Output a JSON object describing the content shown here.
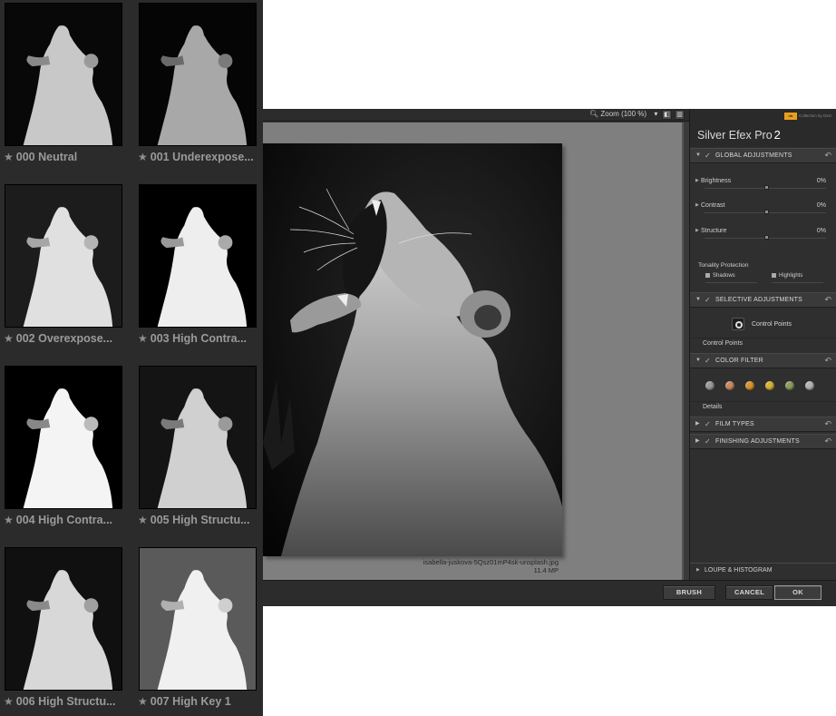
{
  "presets": [
    {
      "label": "000 Neutral"
    },
    {
      "label": "001 Underexpose..."
    },
    {
      "label": "002 Overexpose..."
    },
    {
      "label": "003 High Contra..."
    },
    {
      "label": "004 High Contra..."
    },
    {
      "label": "005 High Structu..."
    },
    {
      "label": "006 High Structu..."
    },
    {
      "label": "007 High Key 1"
    }
  ],
  "toolbar": {
    "zoom_label": "Zoom (100 %)"
  },
  "image": {
    "filename": "isabella-juskova-5Qsz01mP4sk-unsplash.jpg",
    "size": "11.4 MP"
  },
  "brand": {
    "collection": "Collection by DxO",
    "title": "Silver Efex Pro",
    "version": "2"
  },
  "global": {
    "header": "GLOBAL ADJUSTMENTS",
    "sliders": [
      {
        "name": "Brightness",
        "value": "0%"
      },
      {
        "name": "Contrast",
        "value": "0%"
      },
      {
        "name": "Structure",
        "value": "0%"
      }
    ],
    "tonality_label": "Tonality Protection",
    "shadows_label": "Shadows",
    "highlights_label": "Highlights"
  },
  "selective": {
    "header": "SELECTIVE ADJUSTMENTS",
    "control_points_button": "Control Points",
    "control_points_row": "Control Points"
  },
  "color_filter": {
    "header": "COLOR FILTER",
    "details_label": "Details",
    "colors": [
      "#9a9a9a",
      "#c98a60",
      "#d8952e",
      "#d6b632",
      "#8d9e5e",
      "#b3b7b9"
    ]
  },
  "film_types": {
    "header": "FILM TYPES"
  },
  "finishing": {
    "header": "FINISHING ADJUSTMENTS"
  },
  "loupe": {
    "label": "LOUPE & HISTOGRAM"
  },
  "buttons": {
    "brush": "BRUSH",
    "cancel": "CANCEL",
    "ok": "OK"
  }
}
